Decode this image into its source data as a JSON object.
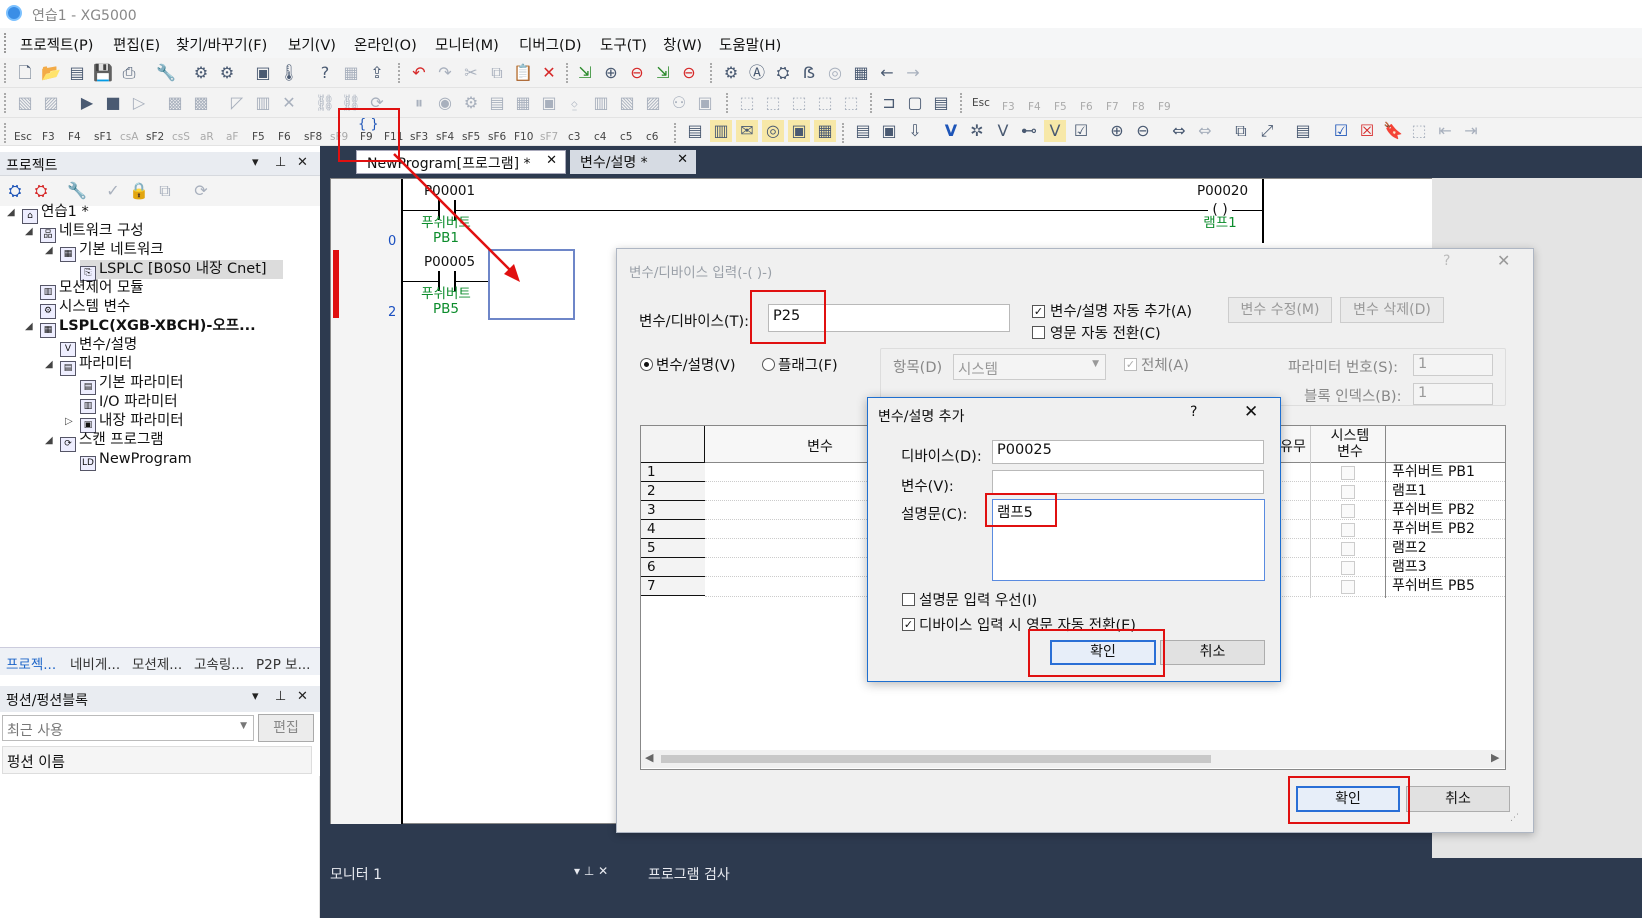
{
  "window": {
    "title": "연습1 - XG5000"
  },
  "menu": [
    "프로젝트(P)",
    "편집(E)",
    "찾기/바꾸기(F)",
    "보기(V)",
    "온라인(O)",
    "모니터(M)",
    "디버그(D)",
    "도구(T)",
    "창(W)",
    "도움말(H)"
  ],
  "toolbar": {
    "row2_keys": [
      "Esc",
      "F3",
      "F4",
      "F5",
      "F6",
      "F7",
      "F8",
      "F9"
    ],
    "row3_keys": [
      "Esc",
      "F3",
      "F4",
      "sF1",
      "csA",
      "sF2",
      "csS",
      "aR",
      "aF",
      "F5",
      "F6",
      "sF8",
      "sF9",
      "F9",
      "F11",
      "sF3",
      "sF4",
      "sF5",
      "sF6",
      "F10",
      "sF7",
      "c3",
      "c4",
      "c5",
      "c6"
    ]
  },
  "project_panel": {
    "title": "프로젝트",
    "tree": [
      {
        "label": "연습1 *"
      },
      {
        "label": "네트워크 구성"
      },
      {
        "label": "기본 네트워크"
      },
      {
        "label": "LSPLC [B0S0 내장 Cnet]"
      },
      {
        "label": "모션제어 모듈"
      },
      {
        "label": "시스템 변수"
      },
      {
        "label": "LSPLC(XGB-XBCH)-오프..."
      },
      {
        "label": "변수/설명"
      },
      {
        "label": "파라미터"
      },
      {
        "label": "기본 파라미터"
      },
      {
        "label": "I/O 파라미터"
      },
      {
        "label": "내장 파라미터"
      },
      {
        "label": "스캔 프로그램"
      },
      {
        "label": "NewProgram"
      }
    ],
    "tabs": [
      "프로젝...",
      "네비게...",
      "모션제...",
      "고속링...",
      "P2P 보..."
    ]
  },
  "function_panel": {
    "title": "펑션/펑션블록",
    "combo_value": "최근 사용",
    "edit_label": "편집",
    "list_header": "펑션 이름"
  },
  "editor": {
    "tabs": [
      {
        "label": "NewProgram[프로그램] *"
      },
      {
        "label": "변수/설명 *"
      }
    ],
    "rungs": [
      {
        "step": "0",
        "contact": "P00001",
        "comment1": "푸쉬버트",
        "comment2": "PB1",
        "coil": "P00020",
        "coil_comment": "램프1"
      },
      {
        "step": "2",
        "contact": "P00005",
        "comment1": "푸쉬버트",
        "comment2": "PB5"
      }
    ]
  },
  "var_dialog": {
    "title": "변수/디바이스 입력(-( )-)",
    "device_label": "변수/디바이스(T):",
    "device_value": "P25",
    "auto_add_label": "변수/설명 자동 추가(A)",
    "auto_add_checked": true,
    "eng_label": "영문 자동 전환(C)",
    "eng_checked": false,
    "modify_btn": "변수 수정(M)",
    "delete_btn": "변수 삭제(D)",
    "radio_var": "변수/설명(V)",
    "radio_flag": "플래그(F)",
    "item_label": "항목(D)",
    "item_value": "시스템",
    "all_label": "전체(A)",
    "param_no_label": "파라미터 번호(S):",
    "param_no_value": "1",
    "block_idx_label": "블록 인덱스(B):",
    "block_idx_value": "1",
    "grid_headers": {
      "var": "변수",
      "use": "유무",
      "sys_line1": "시스템",
      "sys_line2": "변수"
    },
    "rows": [
      {
        "no": "1",
        "comment": "푸쉬버트 PB1"
      },
      {
        "no": "2",
        "comment": "램프1"
      },
      {
        "no": "3",
        "comment": "푸쉬버트 PB2"
      },
      {
        "no": "4",
        "comment": "푸쉬버트 PB2"
      },
      {
        "no": "5",
        "comment": "램프2"
      },
      {
        "no": "6",
        "comment": "램프3"
      },
      {
        "no": "7",
        "comment": "푸쉬버트 PB5"
      }
    ],
    "ok": "확인",
    "cancel": "취소"
  },
  "add_dialog": {
    "title": "변수/설명 추가",
    "help": "?",
    "device_label": "디바이스(D):",
    "device_value": "P00025",
    "var_label": "변수(V):",
    "var_value": "",
    "comment_label": "설명문(C):",
    "comment_value": "램프5",
    "comment_first_label": "설명문 입력 우선(I)",
    "comment_first_checked": false,
    "eng_switch_label": "디바이스 입력 시 영문 자동 전환(E)",
    "eng_switch_checked": true,
    "ok": "확인",
    "cancel": "취소"
  },
  "bottom_panes": [
    "모니터 1",
    "프로그램 검사"
  ],
  "colors": {
    "highlight": "#e01010",
    "editor_bg": "#2d3a4f",
    "comment": "#0c8c2c",
    "step": "#1a4fc0"
  }
}
